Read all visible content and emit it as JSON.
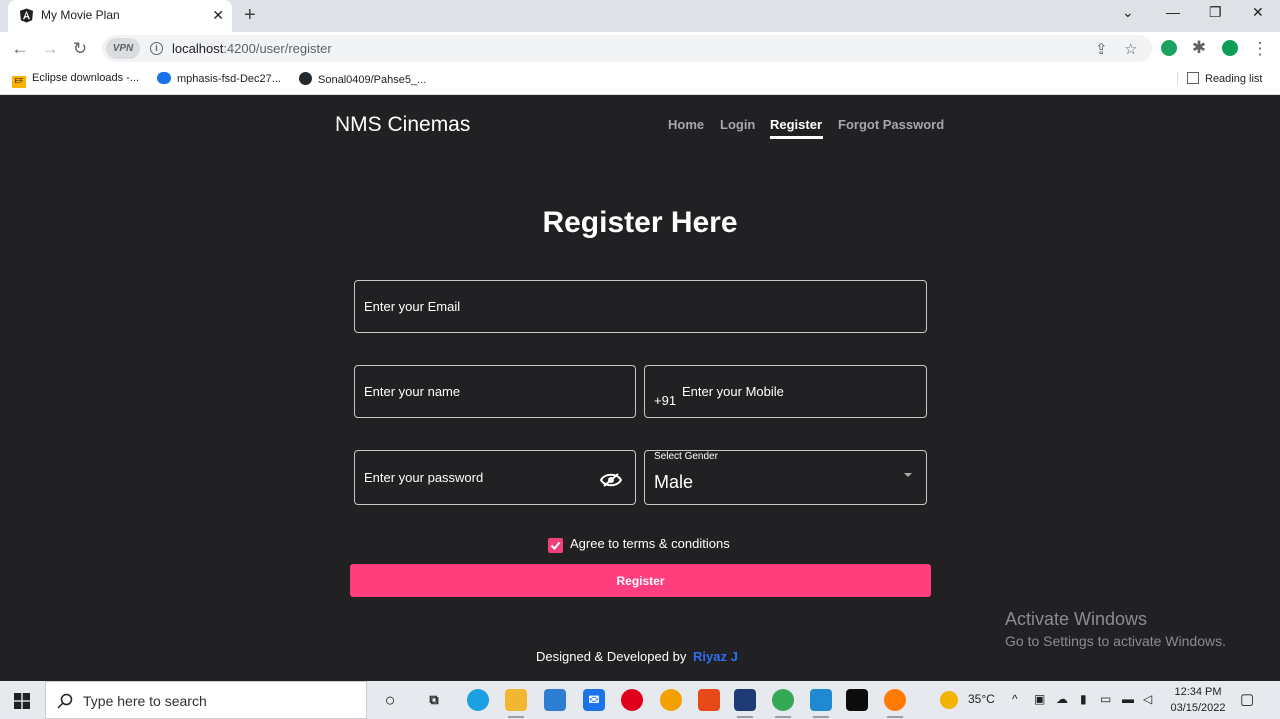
{
  "browser": {
    "tab_title": "My Movie Plan",
    "url_host": "localhost",
    "url_path": ":4200/user/register",
    "vpn_label": "VPN",
    "bookmarks": [
      {
        "label": "Eclipse downloads -...",
        "icon": "eclipse-foundation-icon"
      },
      {
        "label": "mphasis-fsd-Dec27...",
        "icon": "onedrive-cloud-icon"
      },
      {
        "label": "Sonal0409/Pahse5_...",
        "icon": "github-icon"
      }
    ],
    "reading_list": "Reading list"
  },
  "navbar": {
    "brand": "NMS Cinemas",
    "links": [
      "Home",
      "Login",
      "Register",
      "Forgot Password"
    ],
    "active": "Register"
  },
  "form": {
    "heading": "Register Here",
    "email_placeholder": "Enter your Email",
    "name_placeholder": "Enter your name",
    "mobile_prefix": "+91",
    "mobile_placeholder": "Enter your Mobile",
    "password_placeholder": "Enter your password",
    "gender_label": "Select Gender",
    "gender_value": "Male",
    "terms_label": "Agree to terms & conditions",
    "terms_checked": true,
    "submit_label": "Register"
  },
  "footer": {
    "text": "Designed & Developed by",
    "author": "Riyaz J"
  },
  "watermark": {
    "line1": "Activate Windows",
    "line2": "Go to Settings to activate Windows."
  },
  "taskbar": {
    "search_placeholder": "Type here to search",
    "weather": "35°C",
    "time": "12:34 PM",
    "date": "03/15/2022"
  },
  "colors": {
    "page_bg": "#212124",
    "accent_pink": "#fe3e7d",
    "author_blue": "#2f6ef3"
  }
}
